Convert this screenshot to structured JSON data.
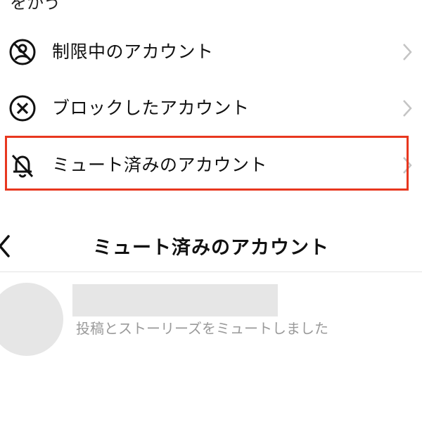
{
  "top_fragment": "をかう",
  "menu": {
    "items": [
      {
        "label": "制限中のアカウント",
        "icon": "restricted-icon"
      },
      {
        "label": "ブロックしたアカウント",
        "icon": "blocked-icon"
      },
      {
        "label": "ミュート済みのアカウント",
        "icon": "muted-bell-icon"
      }
    ],
    "chevron_icon": "chevron-right-icon",
    "highlight_color": "#e8371f"
  },
  "muted_page": {
    "back_icon": "back-chevron-icon",
    "title": "ミュート済みのアカウント",
    "entries": [
      {
        "caption": "投稿とストーリーズをミュートしました"
      }
    ]
  },
  "colors": {
    "text": "#111111",
    "caption": "#9a9a9a",
    "placeholder": "#e6e6e6",
    "divider": "#e3e3e3"
  }
}
